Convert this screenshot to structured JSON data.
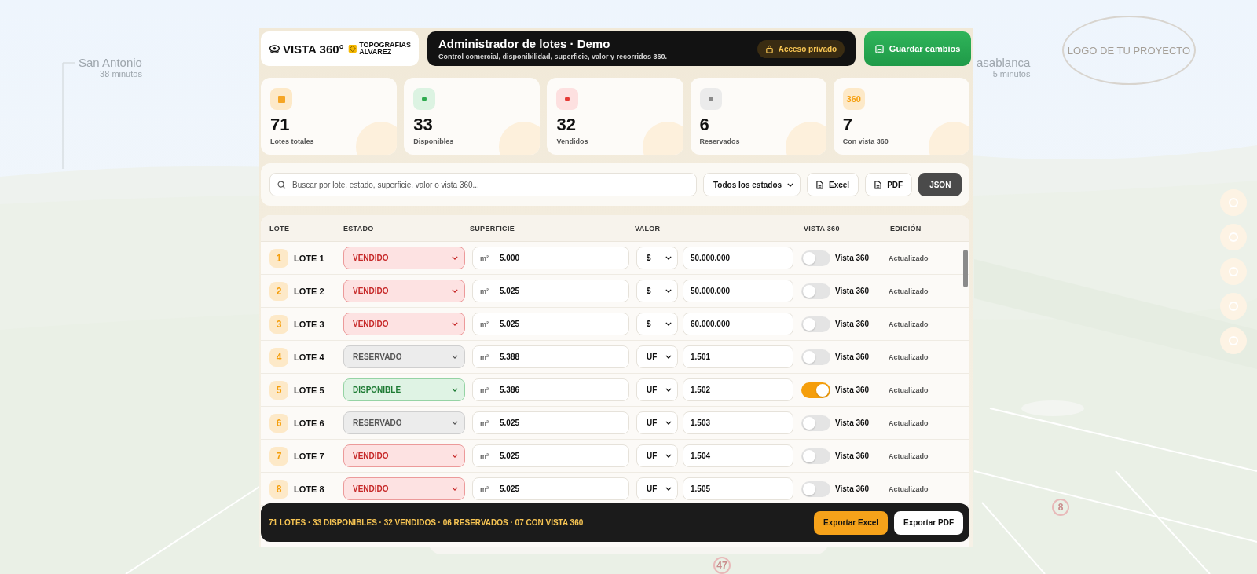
{
  "background": {
    "kind": "picture",
    "places": [
      {
        "name": "San Antonio",
        "time": "38 minutos"
      },
      {
        "name": "asablanca",
        "time": "5 minutos"
      }
    ],
    "project_logo": "LOGO DE TU PROYECTO",
    "markers": [
      "8",
      "47"
    ]
  },
  "brand": {
    "name": "VISTA 360°",
    "partner": "TOPOGRAFIAS ALVAREZ"
  },
  "header": {
    "title": "Administrador de lotes · Demo",
    "subtitle": "Control comercial, disponibilidad, superficie, valor y recorridos 360.",
    "badge": "Acceso privado"
  },
  "save_button": "Guardar cambios",
  "stats": [
    {
      "kind": "total",
      "value": "71",
      "label": "Lotes totales"
    },
    {
      "kind": "available",
      "value": "33",
      "label": "Disponibles"
    },
    {
      "kind": "sold",
      "value": "32",
      "label": "Vendidos"
    },
    {
      "kind": "reserved",
      "value": "6",
      "label": "Reservados"
    },
    {
      "kind": "tour",
      "icon_text": "360",
      "value": "7",
      "label": "Con vista 360"
    }
  ],
  "toolbar": {
    "search_placeholder": "Buscar por lote, estado, superficie, valor o vista 360...",
    "filter": "Todos los estados",
    "buttons": [
      {
        "kind": "excel",
        "label": "Excel"
      },
      {
        "kind": "pdf",
        "label": "PDF"
      },
      {
        "kind": "json",
        "label": "JSON"
      }
    ]
  },
  "table": {
    "columns": [
      "LOTE",
      "ESTADO",
      "SUPERFICIE",
      "VALOR",
      "VISTA 360",
      "EDICIÓN"
    ],
    "rows": [
      {
        "number": "1",
        "name": "LOTE 1",
        "status": "VENDIDO",
        "kind": "sold",
        "area_unit": "m²",
        "area": "5.000",
        "currency": "$",
        "value": "50.000.000",
        "tour_on": false,
        "tour_label": "Vista 360",
        "edit": "Actualizado"
      },
      {
        "number": "2",
        "name": "LOTE 2",
        "status": "VENDIDO",
        "kind": "sold",
        "area_unit": "m²",
        "area": "5.025",
        "currency": "$",
        "value": "50.000.000",
        "tour_on": false,
        "tour_label": "Vista 360",
        "edit": "Actualizado"
      },
      {
        "number": "3",
        "name": "LOTE 3",
        "status": "VENDIDO",
        "kind": "sold",
        "area_unit": "m²",
        "area": "5.025",
        "currency": "$",
        "value": "60.000.000",
        "tour_on": false,
        "tour_label": "Vista 360",
        "edit": "Actualizado"
      },
      {
        "number": "4",
        "name": "LOTE 4",
        "status": "RESERVADO",
        "kind": "reserved",
        "area_unit": "m²",
        "area": "5.388",
        "currency": "UF",
        "value": "1.501",
        "tour_on": false,
        "tour_label": "Vista 360",
        "edit": "Actualizado"
      },
      {
        "number": "5",
        "name": "LOTE 5",
        "status": "DISPONIBLE",
        "kind": "available",
        "area_unit": "m²",
        "area": "5.386",
        "currency": "UF",
        "value": "1.502",
        "tour_on": true,
        "tour_label": "Vista 360",
        "edit": "Actualizado"
      },
      {
        "number": "6",
        "name": "LOTE 6",
        "status": "RESERVADO",
        "kind": "reserved",
        "area_unit": "m²",
        "area": "5.025",
        "currency": "UF",
        "value": "1.503",
        "tour_on": false,
        "tour_label": "Vista 360",
        "edit": "Actualizado"
      },
      {
        "number": "7",
        "name": "LOTE 7",
        "status": "VENDIDO",
        "kind": "sold",
        "area_unit": "m²",
        "area": "5.025",
        "currency": "UF",
        "value": "1.504",
        "tour_on": false,
        "tour_label": "Vista 360",
        "edit": "Actualizado"
      },
      {
        "number": "8",
        "name": "LOTE 8",
        "status": "VENDIDO",
        "kind": "sold",
        "area_unit": "m²",
        "area": "5.025",
        "currency": "UF",
        "value": "1.505",
        "tour_on": false,
        "tour_label": "Vista 360",
        "edit": "Actualizado"
      }
    ]
  },
  "summary": {
    "text": "71 LOTES · 33 DISPONIBLES · 32 VENDIDOS · 06 RESERVADOS · 07 CON VISTA 360",
    "buttons": [
      {
        "kind": "primary",
        "label": "Exportar Excel"
      },
      {
        "kind": "secondary",
        "label": "Exportar PDF"
      }
    ]
  }
}
